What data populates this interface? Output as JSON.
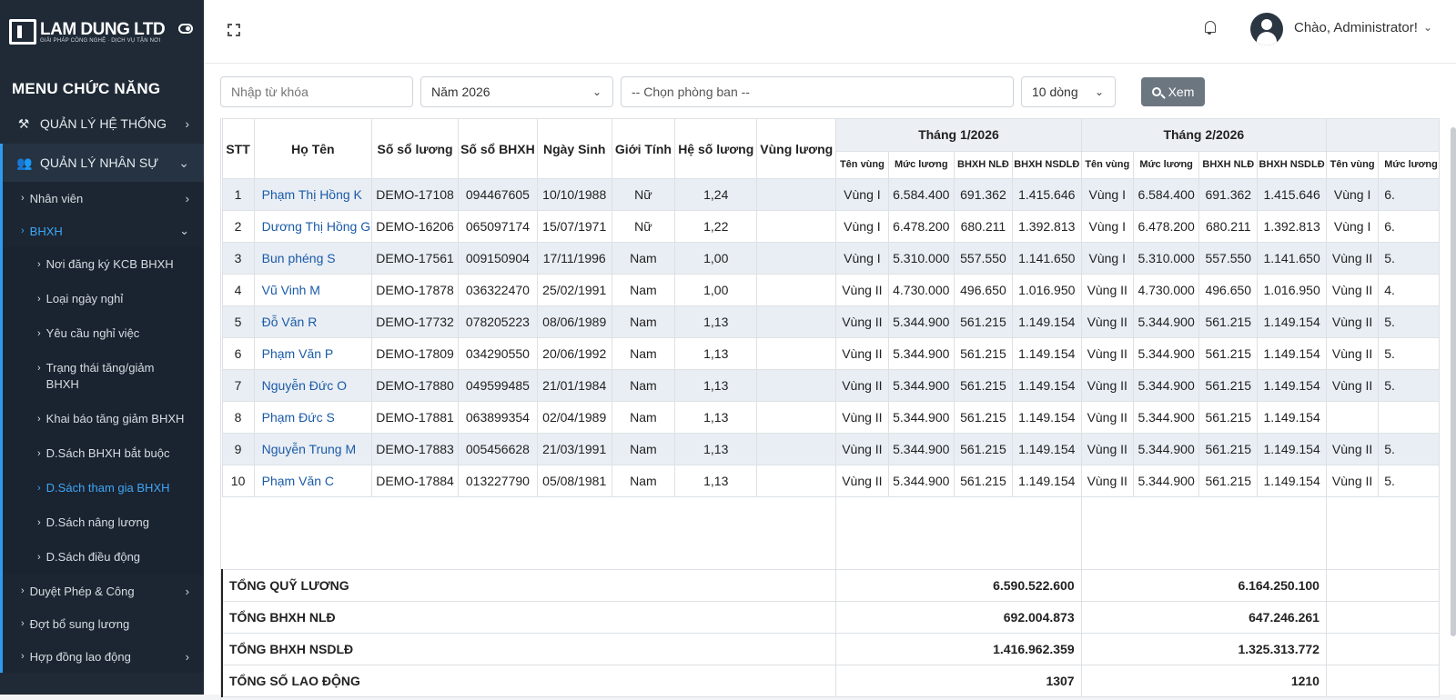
{
  "brand": {
    "name": "LAM DUNG LTD",
    "tagline": "GIẢI PHÁP CÔNG NGHỆ · DỊCH VỤ TẬN NƠI"
  },
  "sidebar": {
    "menu_title": "MENU CHỨC NĂNG",
    "groups": [
      {
        "label": "QUẢN LÝ HỆ THỐNG",
        "icon": "tools-icon"
      },
      {
        "label": "QUẢN LÝ NHÂN SỰ",
        "icon": "users-icon"
      }
    ],
    "items": [
      {
        "label": "Nhân viên"
      },
      {
        "label": "BHXH"
      },
      {
        "label": "Duyệt Phép & Công"
      },
      {
        "label": "Đợt bổ sung lương"
      },
      {
        "label": "Hợp đồng lao động"
      }
    ],
    "bhxh_sub": [
      {
        "label": "Nơi đăng ký KCB BHXH"
      },
      {
        "label": "Loại ngày nghỉ"
      },
      {
        "label": "Yêu cầu nghỉ việc"
      },
      {
        "label": "Trạng thái tăng/giảm BHXH"
      },
      {
        "label": "Khai báo tăng giảm BHXH"
      },
      {
        "label": "D.Sách BHXH bắt buộc"
      },
      {
        "label": "D.Sách tham gia BHXH"
      },
      {
        "label": "D.Sách nâng lương"
      },
      {
        "label": "D.Sách điều động"
      }
    ]
  },
  "header": {
    "greeting": "Chào, Administrator!"
  },
  "filters": {
    "keyword_placeholder": "Nhập từ khóa",
    "year": "Năm 2026",
    "department": "-- Chọn phòng ban --",
    "rows": "10 dòng",
    "view_button": "Xem"
  },
  "table": {
    "columns": [
      "STT",
      "Họ Tên",
      "Số sổ lương",
      "Số sổ BHXH",
      "Ngày Sinh",
      "Giới Tính",
      "Hệ số lương",
      "Vùng lương"
    ],
    "months": [
      "Tháng 1/2026",
      "Tháng 2/2026",
      ""
    ],
    "subcolumns": [
      "Tên vùng",
      "Mức lương",
      "BHXH NLĐ",
      "BHXH NSDLĐ"
    ],
    "rows": [
      {
        "stt": "1",
        "name": "Phạm Thị Hồng K",
        "so_luong": "DEMO-17108",
        "so_bhxh": "094467605",
        "dob": "10/10/1988",
        "gender": "Nữ",
        "hsl": "1,24",
        "vung": "",
        "m1": [
          "Vùng I",
          "6.584.400",
          "691.362",
          "1.415.646"
        ],
        "m2": [
          "Vùng I",
          "6.584.400",
          "691.362",
          "1.415.646"
        ],
        "m3": [
          "Vùng I",
          "6."
        ]
      },
      {
        "stt": "2",
        "name": "Dương Thị Hồng G",
        "so_luong": "DEMO-16206",
        "so_bhxh": "065097174",
        "dob": "15/07/1971",
        "gender": "Nữ",
        "hsl": "1,22",
        "vung": "",
        "m1": [
          "Vùng I",
          "6.478.200",
          "680.211",
          "1.392.813"
        ],
        "m2": [
          "Vùng I",
          "6.478.200",
          "680.211",
          "1.392.813"
        ],
        "m3": [
          "Vùng I",
          "6."
        ]
      },
      {
        "stt": "3",
        "name": "Bun phéng S",
        "so_luong": "DEMO-17561",
        "so_bhxh": "009150904",
        "dob": "17/11/1996",
        "gender": "Nam",
        "hsl": "1,00",
        "vung": "",
        "m1": [
          "Vùng I",
          "5.310.000",
          "557.550",
          "1.141.650"
        ],
        "m2": [
          "Vùng I",
          "5.310.000",
          "557.550",
          "1.141.650"
        ],
        "m3": [
          "Vùng II",
          "5."
        ]
      },
      {
        "stt": "4",
        "name": "Vũ Vinh M",
        "so_luong": "DEMO-17878",
        "so_bhxh": "036322470",
        "dob": "25/02/1991",
        "gender": "Nam",
        "hsl": "1,00",
        "vung": "",
        "m1": [
          "Vùng II",
          "4.730.000",
          "496.650",
          "1.016.950"
        ],
        "m2": [
          "Vùng II",
          "4.730.000",
          "496.650",
          "1.016.950"
        ],
        "m3": [
          "Vùng II",
          "4."
        ]
      },
      {
        "stt": "5",
        "name": "Đỗ Văn R",
        "so_luong": "DEMO-17732",
        "so_bhxh": "078205223",
        "dob": "08/06/1989",
        "gender": "Nam",
        "hsl": "1,13",
        "vung": "",
        "m1": [
          "Vùng II",
          "5.344.900",
          "561.215",
          "1.149.154"
        ],
        "m2": [
          "Vùng II",
          "5.344.900",
          "561.215",
          "1.149.154"
        ],
        "m3": [
          "Vùng II",
          "5."
        ]
      },
      {
        "stt": "6",
        "name": "Phạm Văn P",
        "so_luong": "DEMO-17809",
        "so_bhxh": "034290550",
        "dob": "20/06/1992",
        "gender": "Nam",
        "hsl": "1,13",
        "vung": "",
        "m1": [
          "Vùng II",
          "5.344.900",
          "561.215",
          "1.149.154"
        ],
        "m2": [
          "Vùng II",
          "5.344.900",
          "561.215",
          "1.149.154"
        ],
        "m3": [
          "Vùng II",
          "5."
        ]
      },
      {
        "stt": "7",
        "name": "Nguyễn Đức O",
        "so_luong": "DEMO-17880",
        "so_bhxh": "049599485",
        "dob": "21/01/1984",
        "gender": "Nam",
        "hsl": "1,13",
        "vung": "",
        "m1": [
          "Vùng II",
          "5.344.900",
          "561.215",
          "1.149.154"
        ],
        "m2": [
          "Vùng II",
          "5.344.900",
          "561.215",
          "1.149.154"
        ],
        "m3": [
          "Vùng II",
          "5."
        ]
      },
      {
        "stt": "8",
        "name": "Phạm Đức S",
        "so_luong": "DEMO-17881",
        "so_bhxh": "063899354",
        "dob": "02/04/1989",
        "gender": "Nam",
        "hsl": "1,13",
        "vung": "",
        "m1": [
          "Vùng II",
          "5.344.900",
          "561.215",
          "1.149.154"
        ],
        "m2": [
          "Vùng II",
          "5.344.900",
          "561.215",
          "1.149.154"
        ],
        "m3": [
          "",
          ""
        ]
      },
      {
        "stt": "9",
        "name": "Nguyễn Trung M",
        "so_luong": "DEMO-17883",
        "so_bhxh": "005456628",
        "dob": "21/03/1991",
        "gender": "Nam",
        "hsl": "1,13",
        "vung": "",
        "m1": [
          "Vùng II",
          "5.344.900",
          "561.215",
          "1.149.154"
        ],
        "m2": [
          "Vùng II",
          "5.344.900",
          "561.215",
          "1.149.154"
        ],
        "m3": [
          "Vùng II",
          "5."
        ]
      },
      {
        "stt": "10",
        "name": "Phạm Văn C",
        "so_luong": "DEMO-17884",
        "so_bhxh": "013227790",
        "dob": "05/08/1981",
        "gender": "Nam",
        "hsl": "1,13",
        "vung": "",
        "m1": [
          "Vùng II",
          "5.344.900",
          "561.215",
          "1.149.154"
        ],
        "m2": [
          "Vùng II",
          "5.344.900",
          "561.215",
          "1.149.154"
        ],
        "m3": [
          "Vùng II",
          "5."
        ]
      }
    ],
    "summary": [
      {
        "label": "TỔNG QUỸ LƯƠNG",
        "m1": "6.590.522.600",
        "m2": "6.164.250.100"
      },
      {
        "label": "TỔNG BHXH NLĐ",
        "m1": "692.004.873",
        "m2": "647.246.261"
      },
      {
        "label": "TỔNG BHXH NSDLĐ",
        "m1": "1.416.962.359",
        "m2": "1.325.313.772"
      },
      {
        "label": "TỔNG SỐ LAO ĐỘNG",
        "m1": "1307",
        "m2": "1210"
      }
    ]
  }
}
